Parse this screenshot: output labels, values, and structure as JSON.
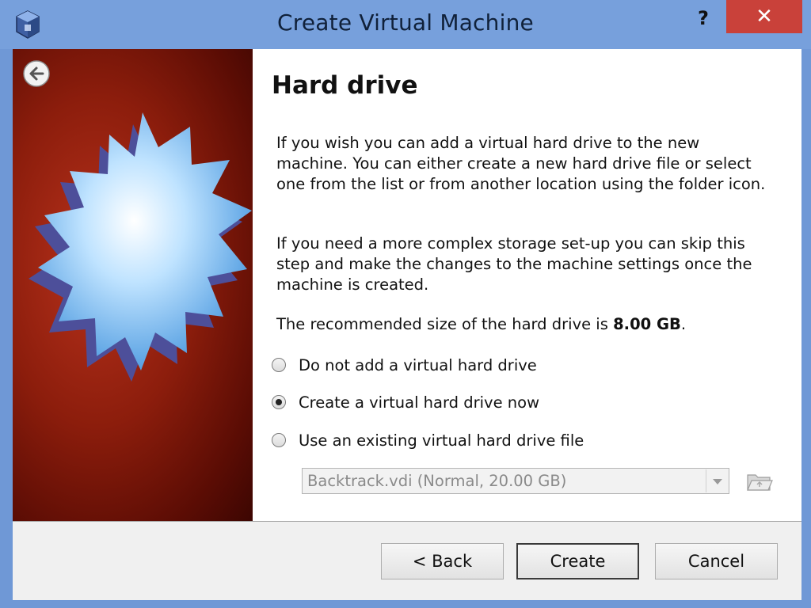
{
  "window": {
    "title": "Create Virtual Machine",
    "help_label": "?",
    "close_label": "✕"
  },
  "page": {
    "heading": "Hard drive",
    "paragraph1": "If you wish you can add a virtual hard drive to the new machine. You can either create a new hard drive file or select one from the list or from another location using the folder icon.",
    "paragraph2": "If you need a more complex storage set-up you can skip this step and make the changes to the machine settings once the machine is created.",
    "recommended_prefix": "The recommended size of the hard drive is ",
    "recommended_size": "8.00 GB",
    "recommended_suffix": "."
  },
  "options": [
    {
      "label": "Do not add a virtual hard drive",
      "checked": false
    },
    {
      "label": "Create a virtual hard drive now",
      "checked": true
    },
    {
      "label": "Use an existing virtual hard drive file",
      "checked": false
    }
  ],
  "existing_file": {
    "selected": "Backtrack.vdi (Normal, 20.00 GB)",
    "enabled": false
  },
  "buttons": {
    "back": "< Back",
    "create": "Create",
    "cancel": "Cancel"
  },
  "icons": {
    "app": "virtualbox-icon",
    "back": "back-arrow-icon",
    "folder": "folder-icon"
  }
}
